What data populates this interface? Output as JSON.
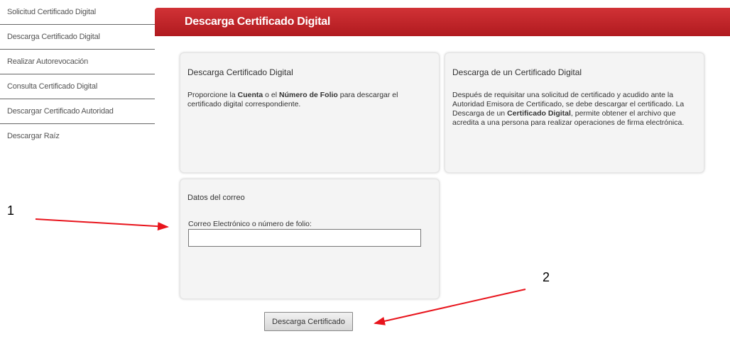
{
  "sidebar": {
    "items": [
      {
        "label": "Solicitud Certificado Digital"
      },
      {
        "label": "Descarga Certificado Digital"
      },
      {
        "label": "Realizar Autorevocación"
      },
      {
        "label": "Consulta Certificado Digital"
      },
      {
        "label": "Descargar Certificado Autoridad"
      },
      {
        "label": "Descargar Raíz"
      }
    ]
  },
  "header": {
    "title": "Descarga Certificado Digital"
  },
  "panel_left": {
    "title": "Descarga Certificado Digital",
    "text_1": "Proporcione la ",
    "bold_1": "Cuenta",
    "text_2": " o el ",
    "bold_2": "Número de Folio",
    "text_3": " para descargar el certificado digital correspondiente."
  },
  "panel_right": {
    "title": "Descarga de un Certificado Digital",
    "text_1": "Después de requisitar una solicitud de certificado y acudido ante la Autoridad Emisora de Certificado, se debe descargar el certificado. La Descarga de un ",
    "bold_1": "Certificado Digital",
    "text_2": ", permite obtener el archivo que acredita a una persona para realizar operaciones de firma electrónica."
  },
  "email_panel": {
    "title": "Datos del correo",
    "label": "Correo Electrónico o número de folio:",
    "value": ""
  },
  "download_button": {
    "label": "Descarga Certificado"
  },
  "annotations": {
    "callout_1": "1",
    "callout_2": "2"
  },
  "colors": {
    "header": "#c0262b",
    "arrow": "#e8141c"
  }
}
